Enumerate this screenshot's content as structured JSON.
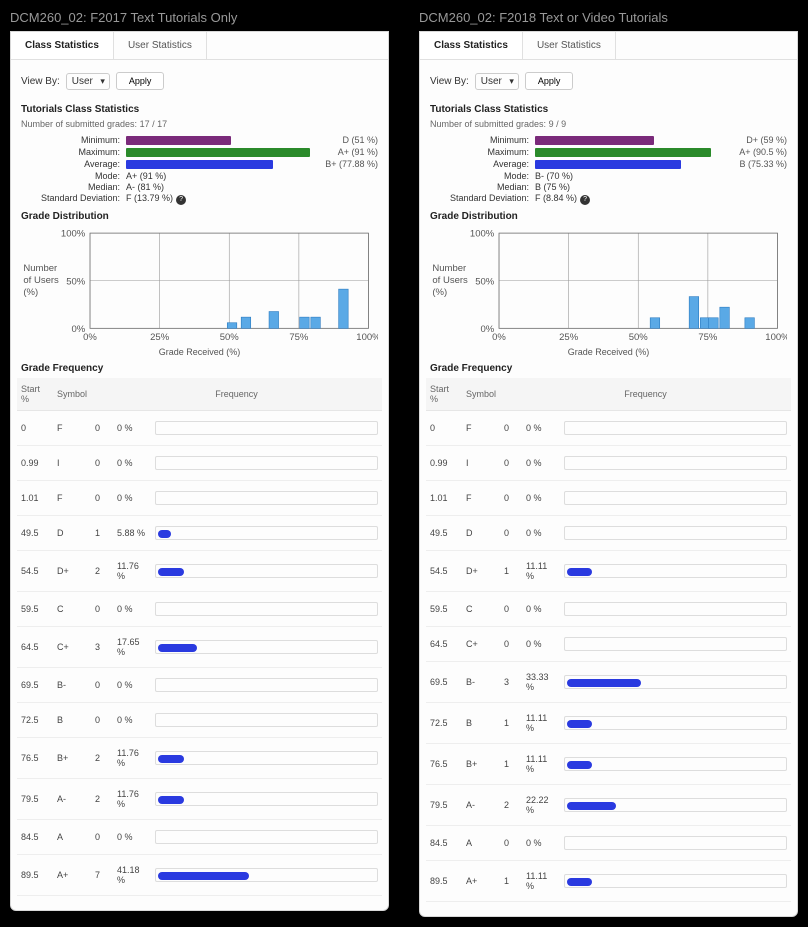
{
  "panels": [
    {
      "title": "DCM260_02: F2017 Text Tutorials Only",
      "tabs": {
        "class": "Class Statistics",
        "user": "User Statistics"
      },
      "viewby": {
        "label": "View By:",
        "value": "User",
        "apply": "Apply"
      },
      "stats_heading": "Tutorials Class Statistics",
      "submitted_label": "Number of submitted grades:",
      "submitted_value": "17 / 17",
      "min_label": "Minimum:",
      "min_text": "D (51 %)",
      "min_pct": 51,
      "max_label": "Maximum:",
      "max_text": "A+ (91 %)",
      "max_pct": 91,
      "avg_label": "Average:",
      "avg_text": "B+ (77.88 %)",
      "avg_pct": 77.88,
      "mode_label": "Mode:",
      "mode_text": "A+ (91 %)",
      "median_label": "Median:",
      "median_text": "A- (81 %)",
      "sd_label": "Standard Deviation:",
      "sd_text": "F (13.79 %)",
      "dist_heading": "Grade Distribution",
      "dist_ylabel": "Number of Users (%)",
      "dist_xlabel": "Grade Received (%)",
      "freq_heading": "Grade Frequency",
      "freq_headers": {
        "start": "Start %",
        "symbol": "Symbol",
        "frequency": "Frequency"
      },
      "freq_rows": [
        {
          "start": "0",
          "symbol": "F",
          "count": 0,
          "pct": "0 %",
          "bar": 0
        },
        {
          "start": "0.99",
          "symbol": "I",
          "count": 0,
          "pct": "0 %",
          "bar": 0
        },
        {
          "start": "1.01",
          "symbol": "F",
          "count": 0,
          "pct": "0 %",
          "bar": 0
        },
        {
          "start": "49.5",
          "symbol": "D",
          "count": 1,
          "pct": "5.88 %",
          "bar": 5.88
        },
        {
          "start": "54.5",
          "symbol": "D+",
          "count": 2,
          "pct": "11.76 %",
          "bar": 11.76
        },
        {
          "start": "59.5",
          "symbol": "C",
          "count": 0,
          "pct": "0 %",
          "bar": 0
        },
        {
          "start": "64.5",
          "symbol": "C+",
          "count": 3,
          "pct": "17.65 %",
          "bar": 17.65
        },
        {
          "start": "69.5",
          "symbol": "B-",
          "count": 0,
          "pct": "0 %",
          "bar": 0
        },
        {
          "start": "72.5",
          "symbol": "B",
          "count": 0,
          "pct": "0 %",
          "bar": 0
        },
        {
          "start": "76.5",
          "symbol": "B+",
          "count": 2,
          "pct": "11.76 %",
          "bar": 11.76
        },
        {
          "start": "79.5",
          "symbol": "A-",
          "count": 2,
          "pct": "11.76 %",
          "bar": 11.76
        },
        {
          "start": "84.5",
          "symbol": "A",
          "count": 0,
          "pct": "0 %",
          "bar": 0
        },
        {
          "start": "89.5",
          "symbol": "A+",
          "count": 7,
          "pct": "41.18 %",
          "bar": 41.18
        }
      ]
    },
    {
      "title": "DCM260_02: F2018 Text or Video Tutorials",
      "tabs": {
        "class": "Class Statistics",
        "user": "User Statistics"
      },
      "viewby": {
        "label": "View By:",
        "value": "User",
        "apply": "Apply"
      },
      "stats_heading": "Tutorials Class Statistics",
      "submitted_label": "Number of submitted grades:",
      "submitted_value": "9 / 9",
      "min_label": "Minimum:",
      "min_text": "D+ (59 %)",
      "min_pct": 59,
      "max_label": "Maximum:",
      "max_text": "A+ (90.5 %)",
      "max_pct": 90.5,
      "avg_label": "Average:",
      "avg_text": "B (75.33 %)",
      "avg_pct": 75.33,
      "mode_label": "Mode:",
      "mode_text": "B- (70 %)",
      "median_label": "Median:",
      "median_text": "B (75 %)",
      "sd_label": "Standard Deviation:",
      "sd_text": "F (8.84 %)",
      "dist_heading": "Grade Distribution",
      "dist_ylabel": "Number of Users (%)",
      "dist_xlabel": "Grade Received (%)",
      "freq_heading": "Grade Frequency",
      "freq_headers": {
        "start": "Start %",
        "symbol": "Symbol",
        "frequency": "Frequency"
      },
      "freq_rows": [
        {
          "start": "0",
          "symbol": "F",
          "count": 0,
          "pct": "0 %",
          "bar": 0
        },
        {
          "start": "0.99",
          "symbol": "I",
          "count": 0,
          "pct": "0 %",
          "bar": 0
        },
        {
          "start": "1.01",
          "symbol": "F",
          "count": 0,
          "pct": "0 %",
          "bar": 0
        },
        {
          "start": "49.5",
          "symbol": "D",
          "count": 0,
          "pct": "0 %",
          "bar": 0
        },
        {
          "start": "54.5",
          "symbol": "D+",
          "count": 1,
          "pct": "11.11 %",
          "bar": 11.11
        },
        {
          "start": "59.5",
          "symbol": "C",
          "count": 0,
          "pct": "0 %",
          "bar": 0
        },
        {
          "start": "64.5",
          "symbol": "C+",
          "count": 0,
          "pct": "0 %",
          "bar": 0
        },
        {
          "start": "69.5",
          "symbol": "B-",
          "count": 3,
          "pct": "33.33 %",
          "bar": 33.33
        },
        {
          "start": "72.5",
          "symbol": "B",
          "count": 1,
          "pct": "11.11 %",
          "bar": 11.11
        },
        {
          "start": "76.5",
          "symbol": "B+",
          "count": 1,
          "pct": "11.11 %",
          "bar": 11.11
        },
        {
          "start": "79.5",
          "symbol": "A-",
          "count": 2,
          "pct": "22.22 %",
          "bar": 22.22
        },
        {
          "start": "84.5",
          "symbol": "A",
          "count": 0,
          "pct": "0 %",
          "bar": 0
        },
        {
          "start": "89.5",
          "symbol": "A+",
          "count": 1,
          "pct": "11.11 %",
          "bar": 11.11
        }
      ]
    }
  ],
  "chart_data": [
    {
      "type": "bar",
      "title": "Grade Distribution",
      "xlabel": "Grade Received (%)",
      "ylabel": "Number of Users (%)",
      "ylim": [
        0,
        100
      ],
      "yticks": [
        0,
        50,
        100
      ],
      "xticks": [
        0,
        25,
        50,
        75,
        100
      ],
      "x": [
        51,
        56,
        66,
        77,
        81,
        91
      ],
      "values": [
        5.88,
        11.76,
        17.65,
        11.76,
        11.76,
        41.18
      ]
    },
    {
      "type": "bar",
      "title": "Grade Distribution",
      "xlabel": "Grade Received (%)",
      "ylabel": "Number of Users (%)",
      "ylim": [
        0,
        100
      ],
      "yticks": [
        0,
        50,
        100
      ],
      "xticks": [
        0,
        25,
        50,
        75,
        100
      ],
      "x": [
        56,
        70,
        74,
        77,
        81,
        90
      ],
      "values": [
        11.11,
        33.33,
        11.11,
        11.11,
        22.22,
        11.11
      ]
    }
  ]
}
